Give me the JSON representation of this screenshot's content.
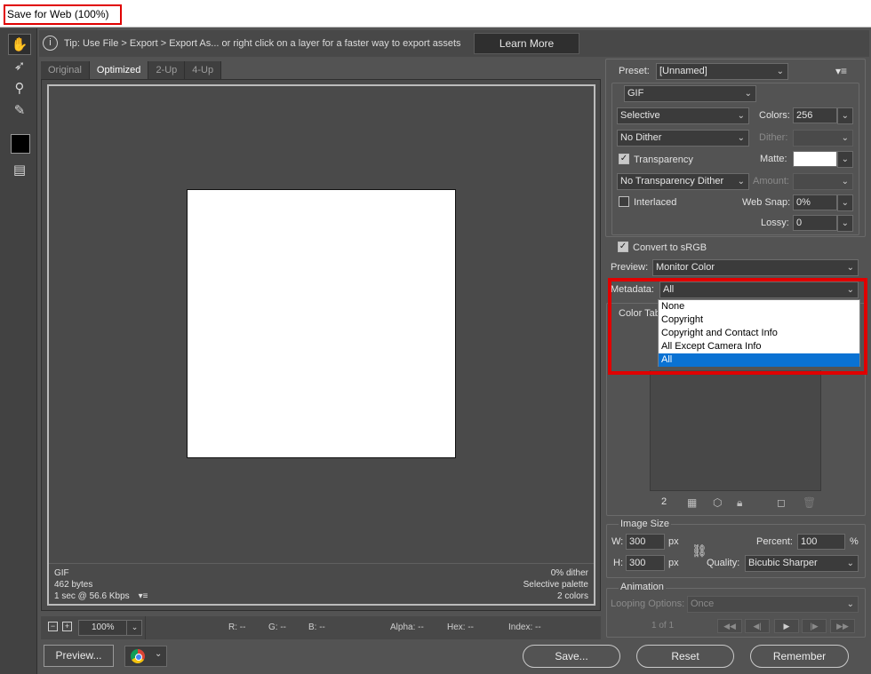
{
  "window": {
    "title": "Save for Web (100%)"
  },
  "tools": [
    {
      "name": "hand-tool",
      "glyph": "✋"
    },
    {
      "name": "slice-select-tool",
      "glyph": "➶"
    },
    {
      "name": "zoom-tool",
      "glyph": "⚲"
    },
    {
      "name": "eyedropper-tool",
      "glyph": "✎"
    },
    {
      "name": "slices-visibility-toggle",
      "glyph": "▤"
    }
  ],
  "tip": {
    "icon": "info-icon",
    "text": "Tip: Use File > Export > Export As...  or right click on a layer for a faster way to export assets",
    "button": "Learn More"
  },
  "tabs": [
    "Original",
    "Optimized",
    "2-Up",
    "4-Up"
  ],
  "preview_info": {
    "left": [
      "GIF",
      "462 bytes",
      "1 sec @ 56.6 Kbps"
    ],
    "right": [
      "0% dither",
      "Selective palette",
      "2 colors"
    ]
  },
  "statusbar": {
    "zoom": "100%",
    "r": "R: --",
    "g": "G: --",
    "b": "B: --",
    "alpha": "Alpha: --",
    "hex": "Hex: --",
    "index": "Index: --"
  },
  "buttons": {
    "preview": "Preview...",
    "save": "Save...",
    "reset": "Reset",
    "remember": "Remember"
  },
  "settings": {
    "preset_label": "Preset:",
    "preset_value": "[Unnamed]",
    "format": "GIF",
    "reduction": "Selective",
    "colors_label": "Colors:",
    "colors_value": "256",
    "dither_algo": "No Dither",
    "dither_label": "Dither:",
    "transparency_label": "Transparency",
    "matte_label": "Matte:",
    "transparency_dither": "No Transparency Dither",
    "amount_label": "Amount:",
    "interlaced_label": "Interlaced",
    "websnap_label": "Web Snap:",
    "websnap_value": "0%",
    "lossy_label": "Lossy:",
    "lossy_value": "0",
    "convert_label": "Convert to sRGB",
    "preview_label": "Preview:",
    "preview_value": "Monitor Color",
    "metadata_label": "Metadata:",
    "metadata_value": "All",
    "metadata_options": [
      "None",
      "Copyright",
      "Copyright and Contact Info",
      "All Except Camera Info",
      "All"
    ],
    "color_table_label": "Color Tab",
    "color_count": "2"
  },
  "image_size": {
    "title": "Image Size",
    "w_label": "W:",
    "w_value": "300",
    "h_label": "H:",
    "h_value": "300",
    "unit": "px",
    "percent_label": "Percent:",
    "percent_value": "100",
    "percent_unit": "%",
    "quality_label": "Quality:",
    "quality_value": "Bicubic Sharper"
  },
  "animation": {
    "title": "Animation",
    "looping_label": "Looping Options:",
    "looping_value": "Once",
    "frame_counter": "1 of 1"
  }
}
